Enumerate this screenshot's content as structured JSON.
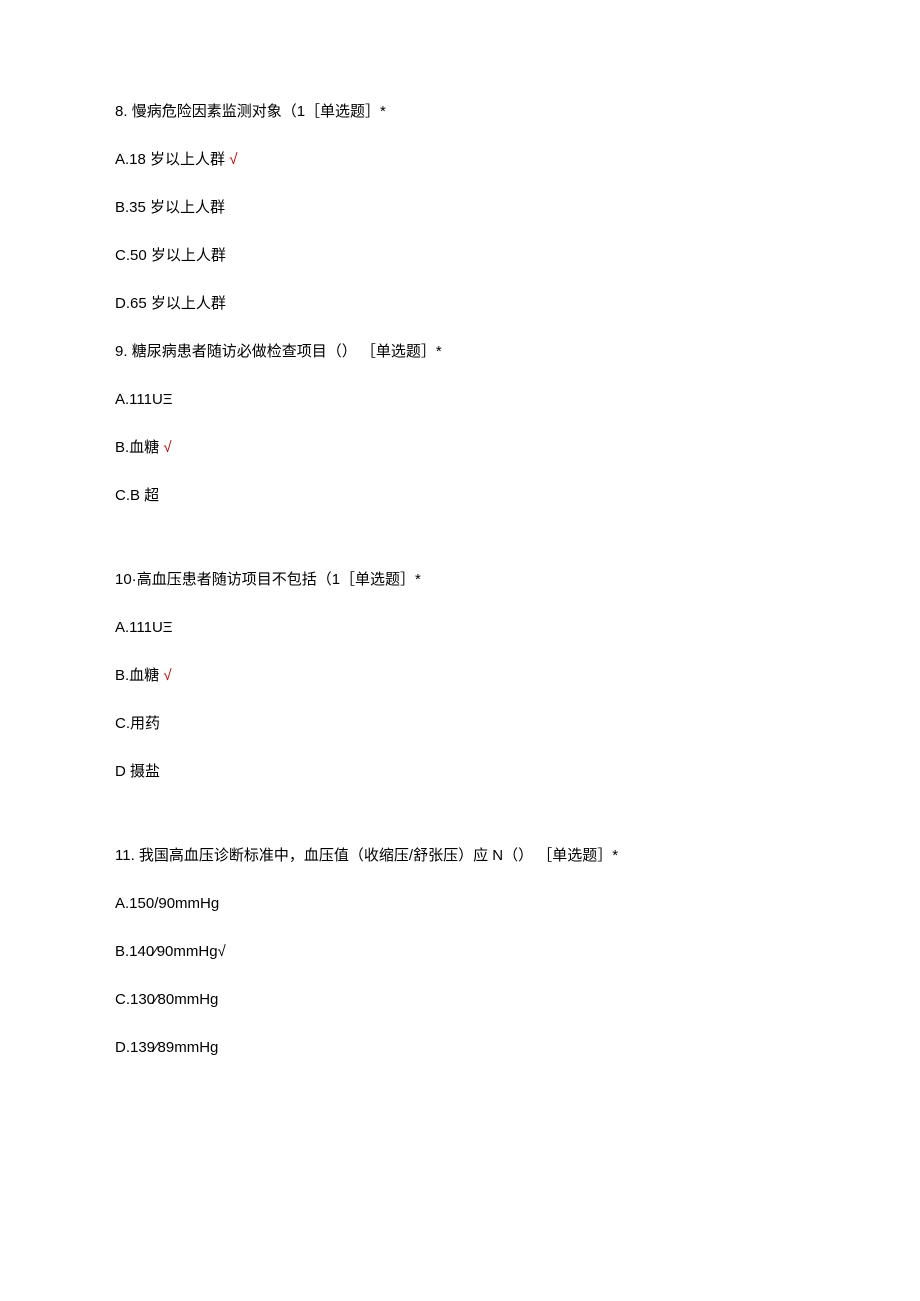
{
  "questions": [
    {
      "number": "8.",
      "text": "慢病危险因素监测对象（1［单选题］*",
      "options": [
        {
          "label": "A.18 岁以上人群",
          "correct": true
        },
        {
          "label": "B.35 岁以上人群",
          "correct": false
        },
        {
          "label": "C.50 岁以上人群",
          "correct": false
        },
        {
          "label": "D.65 岁以上人群",
          "correct": false
        }
      ]
    },
    {
      "number": "9.",
      "text": "糖尿病患者随访必做检查项目（） ［单选题］*",
      "options": [
        {
          "label": "A.111UΞ",
          "correct": false
        },
        {
          "label": "B.血糖",
          "correct": true
        },
        {
          "label": "C.B 超",
          "correct": false
        }
      ]
    },
    {
      "number": "10·",
      "text": "高血压患者随访项目不包括（1［单选题］*",
      "options": [
        {
          "label": "A.111UΞ",
          "correct": false
        },
        {
          "label": "B.血糖",
          "correct": true
        },
        {
          "label": "C.用药",
          "correct": false
        },
        {
          "label": "D 摄盐",
          "correct": false
        }
      ]
    },
    {
      "number": "11.",
      "text": "我国高血压诊断标准中，血压值（收缩压/舒张压）应 N（） ［单选题］*",
      "options": [
        {
          "label": "A.150/90mmHg",
          "correct": false
        },
        {
          "label": "B.140⁄90mmHg√",
          "correct": false
        },
        {
          "label": "C.130⁄80mmHg",
          "correct": false
        },
        {
          "label": "D.139⁄89mmHg",
          "correct": false
        }
      ]
    }
  ],
  "check_symbol": "√"
}
